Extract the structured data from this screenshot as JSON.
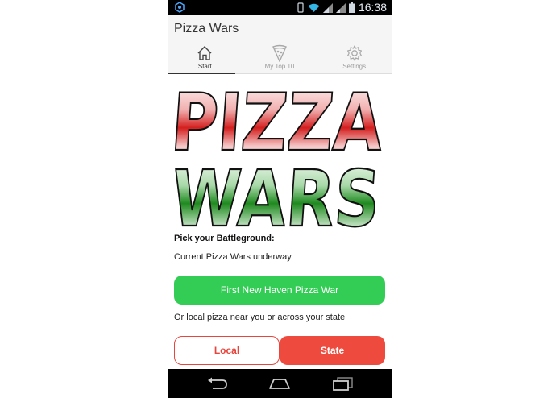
{
  "status_bar": {
    "time": "16:38",
    "icons": [
      "wifi-icon",
      "signal-icon",
      "battery-icon"
    ],
    "left_icon": "notification-icon"
  },
  "action_bar": {
    "title": "Pizza Wars"
  },
  "tabs": [
    {
      "label": "Start",
      "icon": "home-icon",
      "active": true
    },
    {
      "label": "My Top 10",
      "icon": "pizza-slice-icon",
      "active": false
    },
    {
      "label": "Settings",
      "icon": "gear-icon",
      "active": false
    }
  ],
  "logo": {
    "line1": "PIZZA",
    "line2": "WARS"
  },
  "content": {
    "pick_heading": "Pick your Battleground:",
    "current_text": "Current Pizza Wars underway",
    "war_button": "First New Haven Pizza War",
    "or_text": "Or local pizza near you or across your state",
    "local_button": "Local",
    "state_button": "State"
  },
  "nav_bar": {
    "buttons": [
      "back-icon",
      "home-icon",
      "recent-apps-icon"
    ]
  },
  "colors": {
    "green_button": "#33cc55",
    "red_button": "#ee4b3e",
    "red_outline": "#e8453c"
  }
}
